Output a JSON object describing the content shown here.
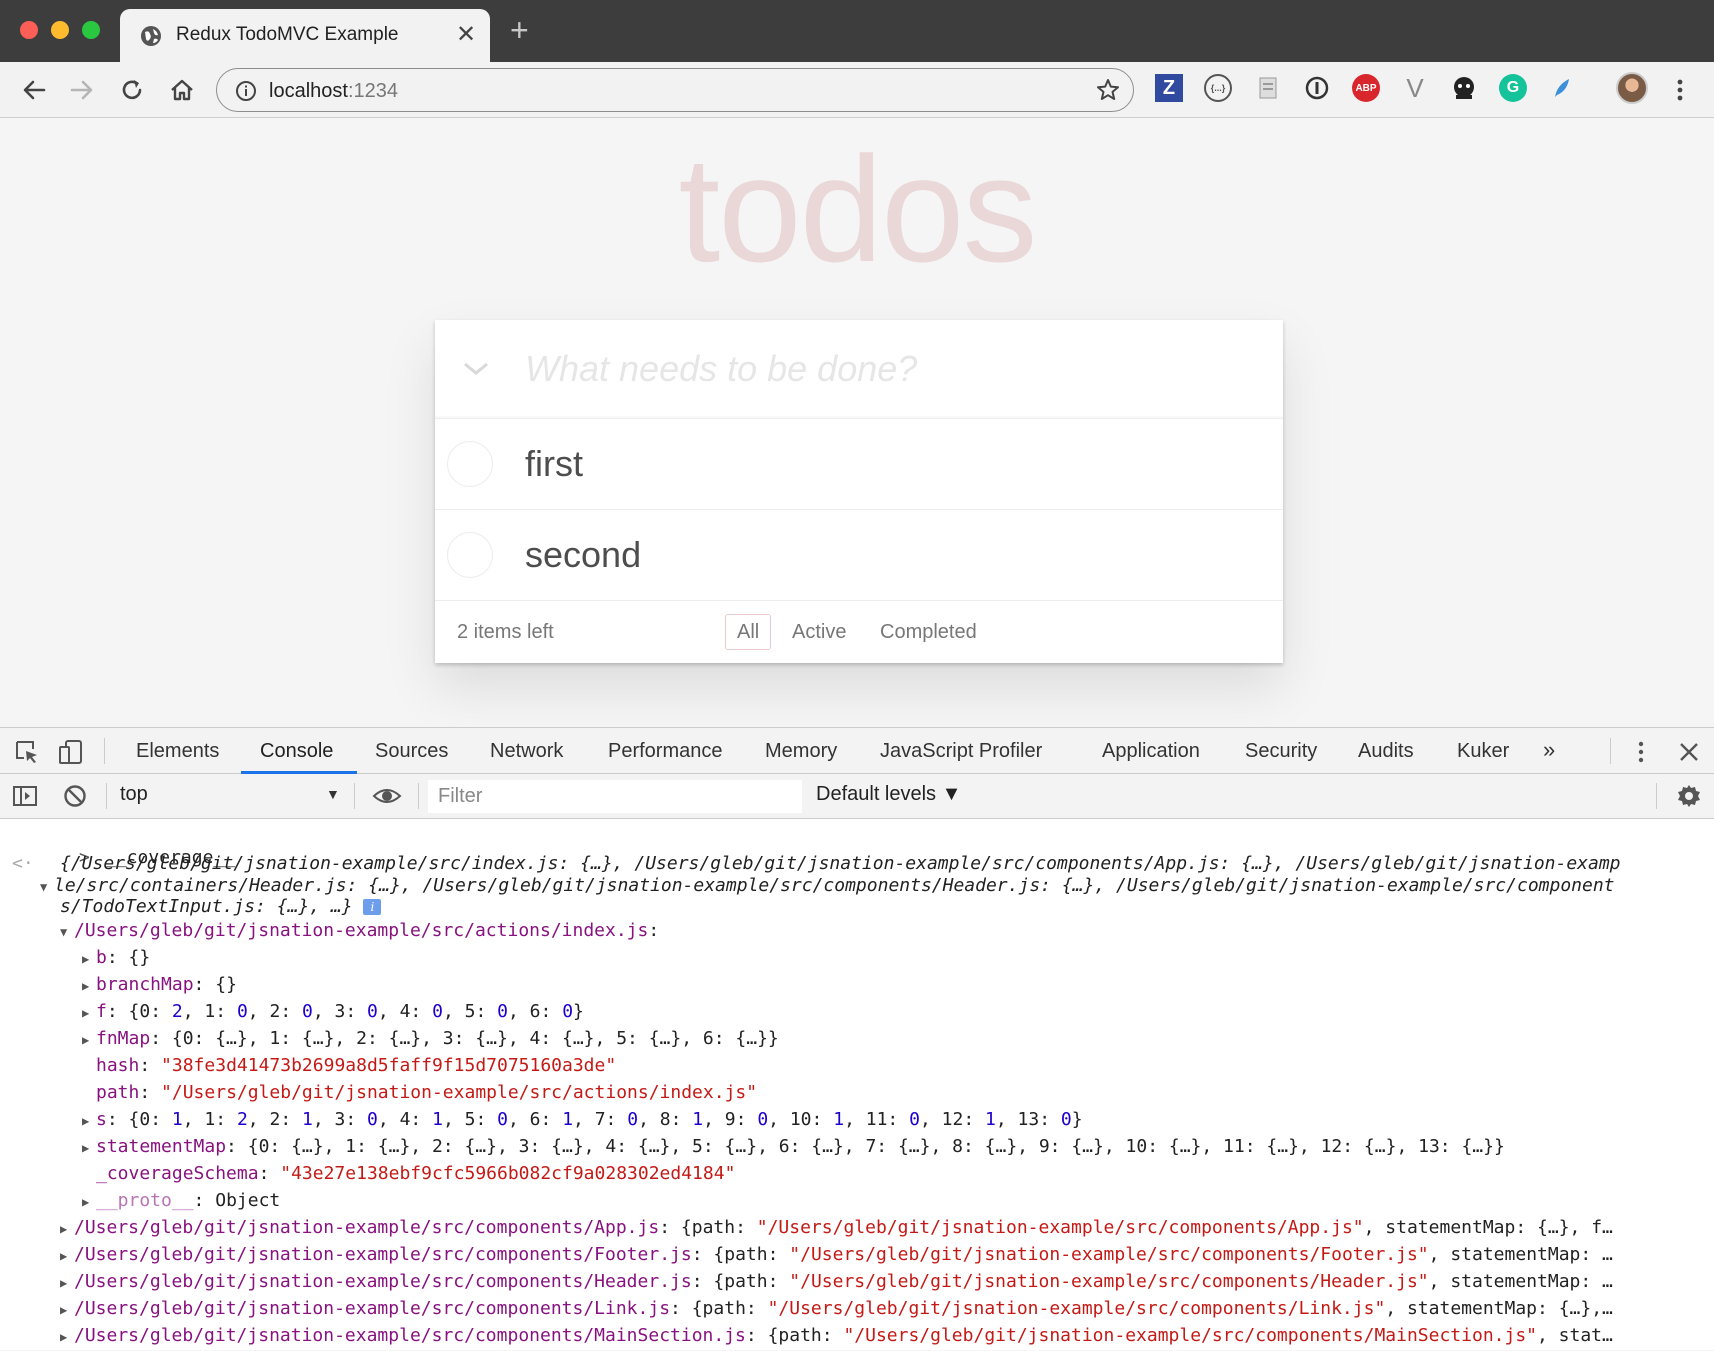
{
  "browser": {
    "tab_title": "Redux TodoMVC Example",
    "url_host": "localhost",
    "url_port": ":1234",
    "extensions": [
      "Z",
      "{...}",
      "ABP",
      "V",
      "G"
    ]
  },
  "todo": {
    "app_title": "todos",
    "new_todo_placeholder": "What needs to be done?",
    "items": [
      {
        "label": "first",
        "completed": false
      },
      {
        "label": "second",
        "completed": false
      }
    ],
    "items_left": "2 items left",
    "filters": [
      "All",
      "Active",
      "Completed"
    ],
    "selected_filter": "All"
  },
  "devtools": {
    "tabs": [
      "Elements",
      "Console",
      "Sources",
      "Network",
      "Performance",
      "Memory",
      "JavaScript Profiler",
      "Application",
      "Security",
      "Audits",
      "Kuker"
    ],
    "more_tabs": "»",
    "active_tab": "Console",
    "context": "top",
    "filter_placeholder": "Filter",
    "levels": "Default levels ▼"
  },
  "console": {
    "input": "__coverage__",
    "summary_line1": "{/Users/gleb/git/jsnation-example/src/index.js: {…}, /Users/gleb/git/jsnation-example/src/components/App.js: {…}, /Users/gleb/git/jsnation-examp",
    "summary_line2": "le/src/containers/Header.js: {…}, /Users/gleb/git/jsnation-example/src/components/Header.js: {…}, /Users/gleb/git/jsnation-example/src/component",
    "summary_line3": "s/TodoTextInput.js: {…}, …}",
    "expanded_key": "/Users/gleb/git/jsnation-example/src/actions/index.js",
    "props": {
      "b_key": "b",
      "b_val": "{}",
      "branchMap_key": "branchMap",
      "branchMap_val": "{}",
      "f_key": "f",
      "f_val": "{0: 2, 1: 0, 2: 0, 3: 0, 4: 0, 5: 0, 6: 0}",
      "fnMap_key": "fnMap",
      "fnMap_val": "{0: {…}, 1: {…}, 2: {…}, 3: {…}, 4: {…}, 5: {…}, 6: {…}}",
      "hash_key": "hash",
      "hash_val": "\"38fe3d41473b2699a8d5faff9f15d7075160a3de\"",
      "path_key": "path",
      "path_val": "\"/Users/gleb/git/jsnation-example/src/actions/index.js\"",
      "s_key": "s",
      "s_val": "{0: 1, 1: 2, 2: 1, 3: 0, 4: 1, 5: 0, 6: 1, 7: 0, 8: 1, 9: 0, 10: 1, 11: 0, 12: 1, 13: 0}",
      "statementMap_key": "statementMap",
      "statementMap_val": "{0: {…}, 1: {…}, 2: {…}, 3: {…}, 4: {…}, 5: {…}, 6: {…}, 7: {…}, 8: {…}, 9: {…}, 10: {…}, 11: {…}, 12: {…}, 13: {…}}",
      "schema_key": "_coverageSchema",
      "schema_val": "\"43e27e138ebf9cfc5966b082cf9a028302ed4184\"",
      "proto_key": "__proto__",
      "proto_val": "Object"
    },
    "collapsed": [
      {
        "key": "/Users/gleb/git/jsnation-example/src/components/App.js",
        "pre": "{path: ",
        "path": "\"/Users/gleb/git/jsnation-example/src/components/App.js\"",
        "post": ", statementMap: {…}, f…"
      },
      {
        "key": "/Users/gleb/git/jsnation-example/src/components/Footer.js",
        "pre": "{path: ",
        "path": "\"/Users/gleb/git/jsnation-example/src/components/Footer.js\"",
        "post": ", statementMap: …"
      },
      {
        "key": "/Users/gleb/git/jsnation-example/src/components/Header.js",
        "pre": "{path: ",
        "path": "\"/Users/gleb/git/jsnation-example/src/components/Header.js\"",
        "post": ", statementMap: …"
      },
      {
        "key": "/Users/gleb/git/jsnation-example/src/components/Link.js",
        "pre": "{path: ",
        "path": "\"/Users/gleb/git/jsnation-example/src/components/Link.js\"",
        "post": ", statementMap: {…},…"
      },
      {
        "key": "/Users/gleb/git/jsnation-example/src/components/MainSection.js",
        "pre": "{path: ",
        "path": "\"/Users/gleb/git/jsnation-example/src/components/MainSection.js\"",
        "post": ", stat…"
      }
    ]
  }
}
